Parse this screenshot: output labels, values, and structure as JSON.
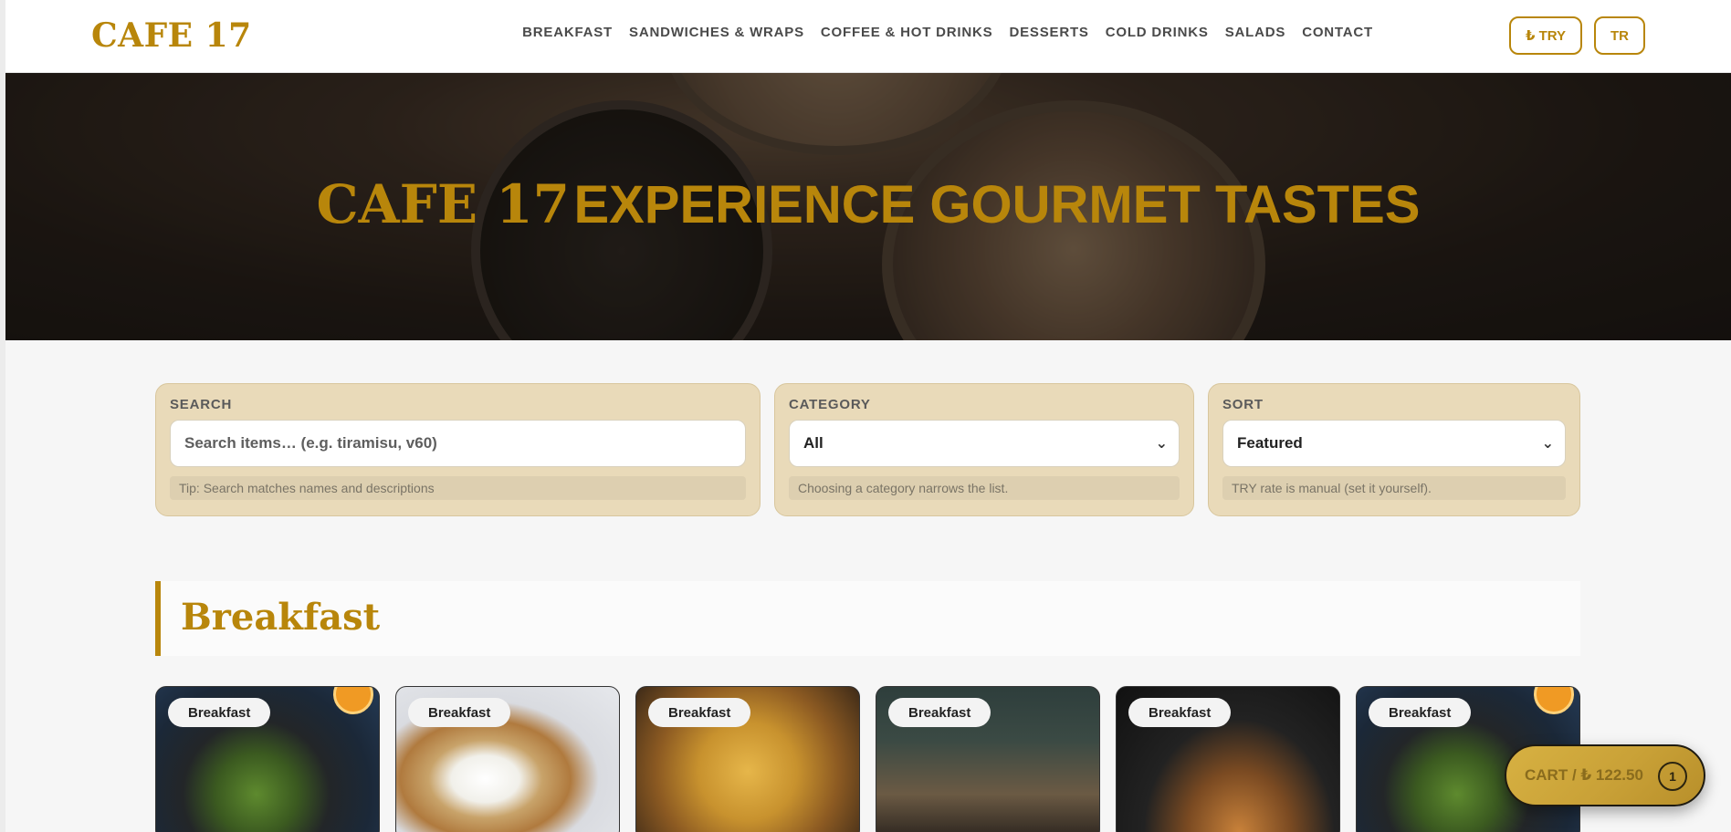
{
  "header": {
    "logo": "CAFE 17",
    "nav": [
      "BREAKFAST",
      "SANDWICHES & WRAPS",
      "COFFEE & HOT DRINKS",
      "DESSERTS",
      "COLD DRINKS",
      "SALADS",
      "CONTACT"
    ],
    "currency_button": "₺ TRY",
    "language_button": "TR"
  },
  "hero": {
    "brand": "CAFE 17",
    "tagline": "EXPERIENCE GOURMET TASTES"
  },
  "filters": {
    "search": {
      "label": "SEARCH",
      "placeholder": "Search items… (e.g. tiramisu, v60)",
      "hint": "Tip: Search matches names and descriptions"
    },
    "category": {
      "label": "CATEGORY",
      "value": "All",
      "hint": "Choosing a category narrows the list."
    },
    "sort": {
      "label": "SORT",
      "value": "Featured",
      "hint": "TRY rate is manual (set it yourself)."
    }
  },
  "section": {
    "title": "Breakfast"
  },
  "items": [
    {
      "badge": "Breakfast",
      "image": "salad-bowl-image"
    },
    {
      "badge": "Breakfast",
      "image": "fried-egg-toast-image"
    },
    {
      "badge": "Breakfast",
      "image": "pasta-image"
    },
    {
      "badge": "Breakfast",
      "image": "cafe-interior-image"
    },
    {
      "badge": "Breakfast",
      "image": "croissant-image"
    },
    {
      "badge": "Breakfast",
      "image": "salad-bowl-image"
    }
  ],
  "cart": {
    "label": "CART / ₺ 122.50",
    "count": "1"
  },
  "colors": {
    "accent": "#b8860b",
    "filter_card": "#e9dab9"
  }
}
